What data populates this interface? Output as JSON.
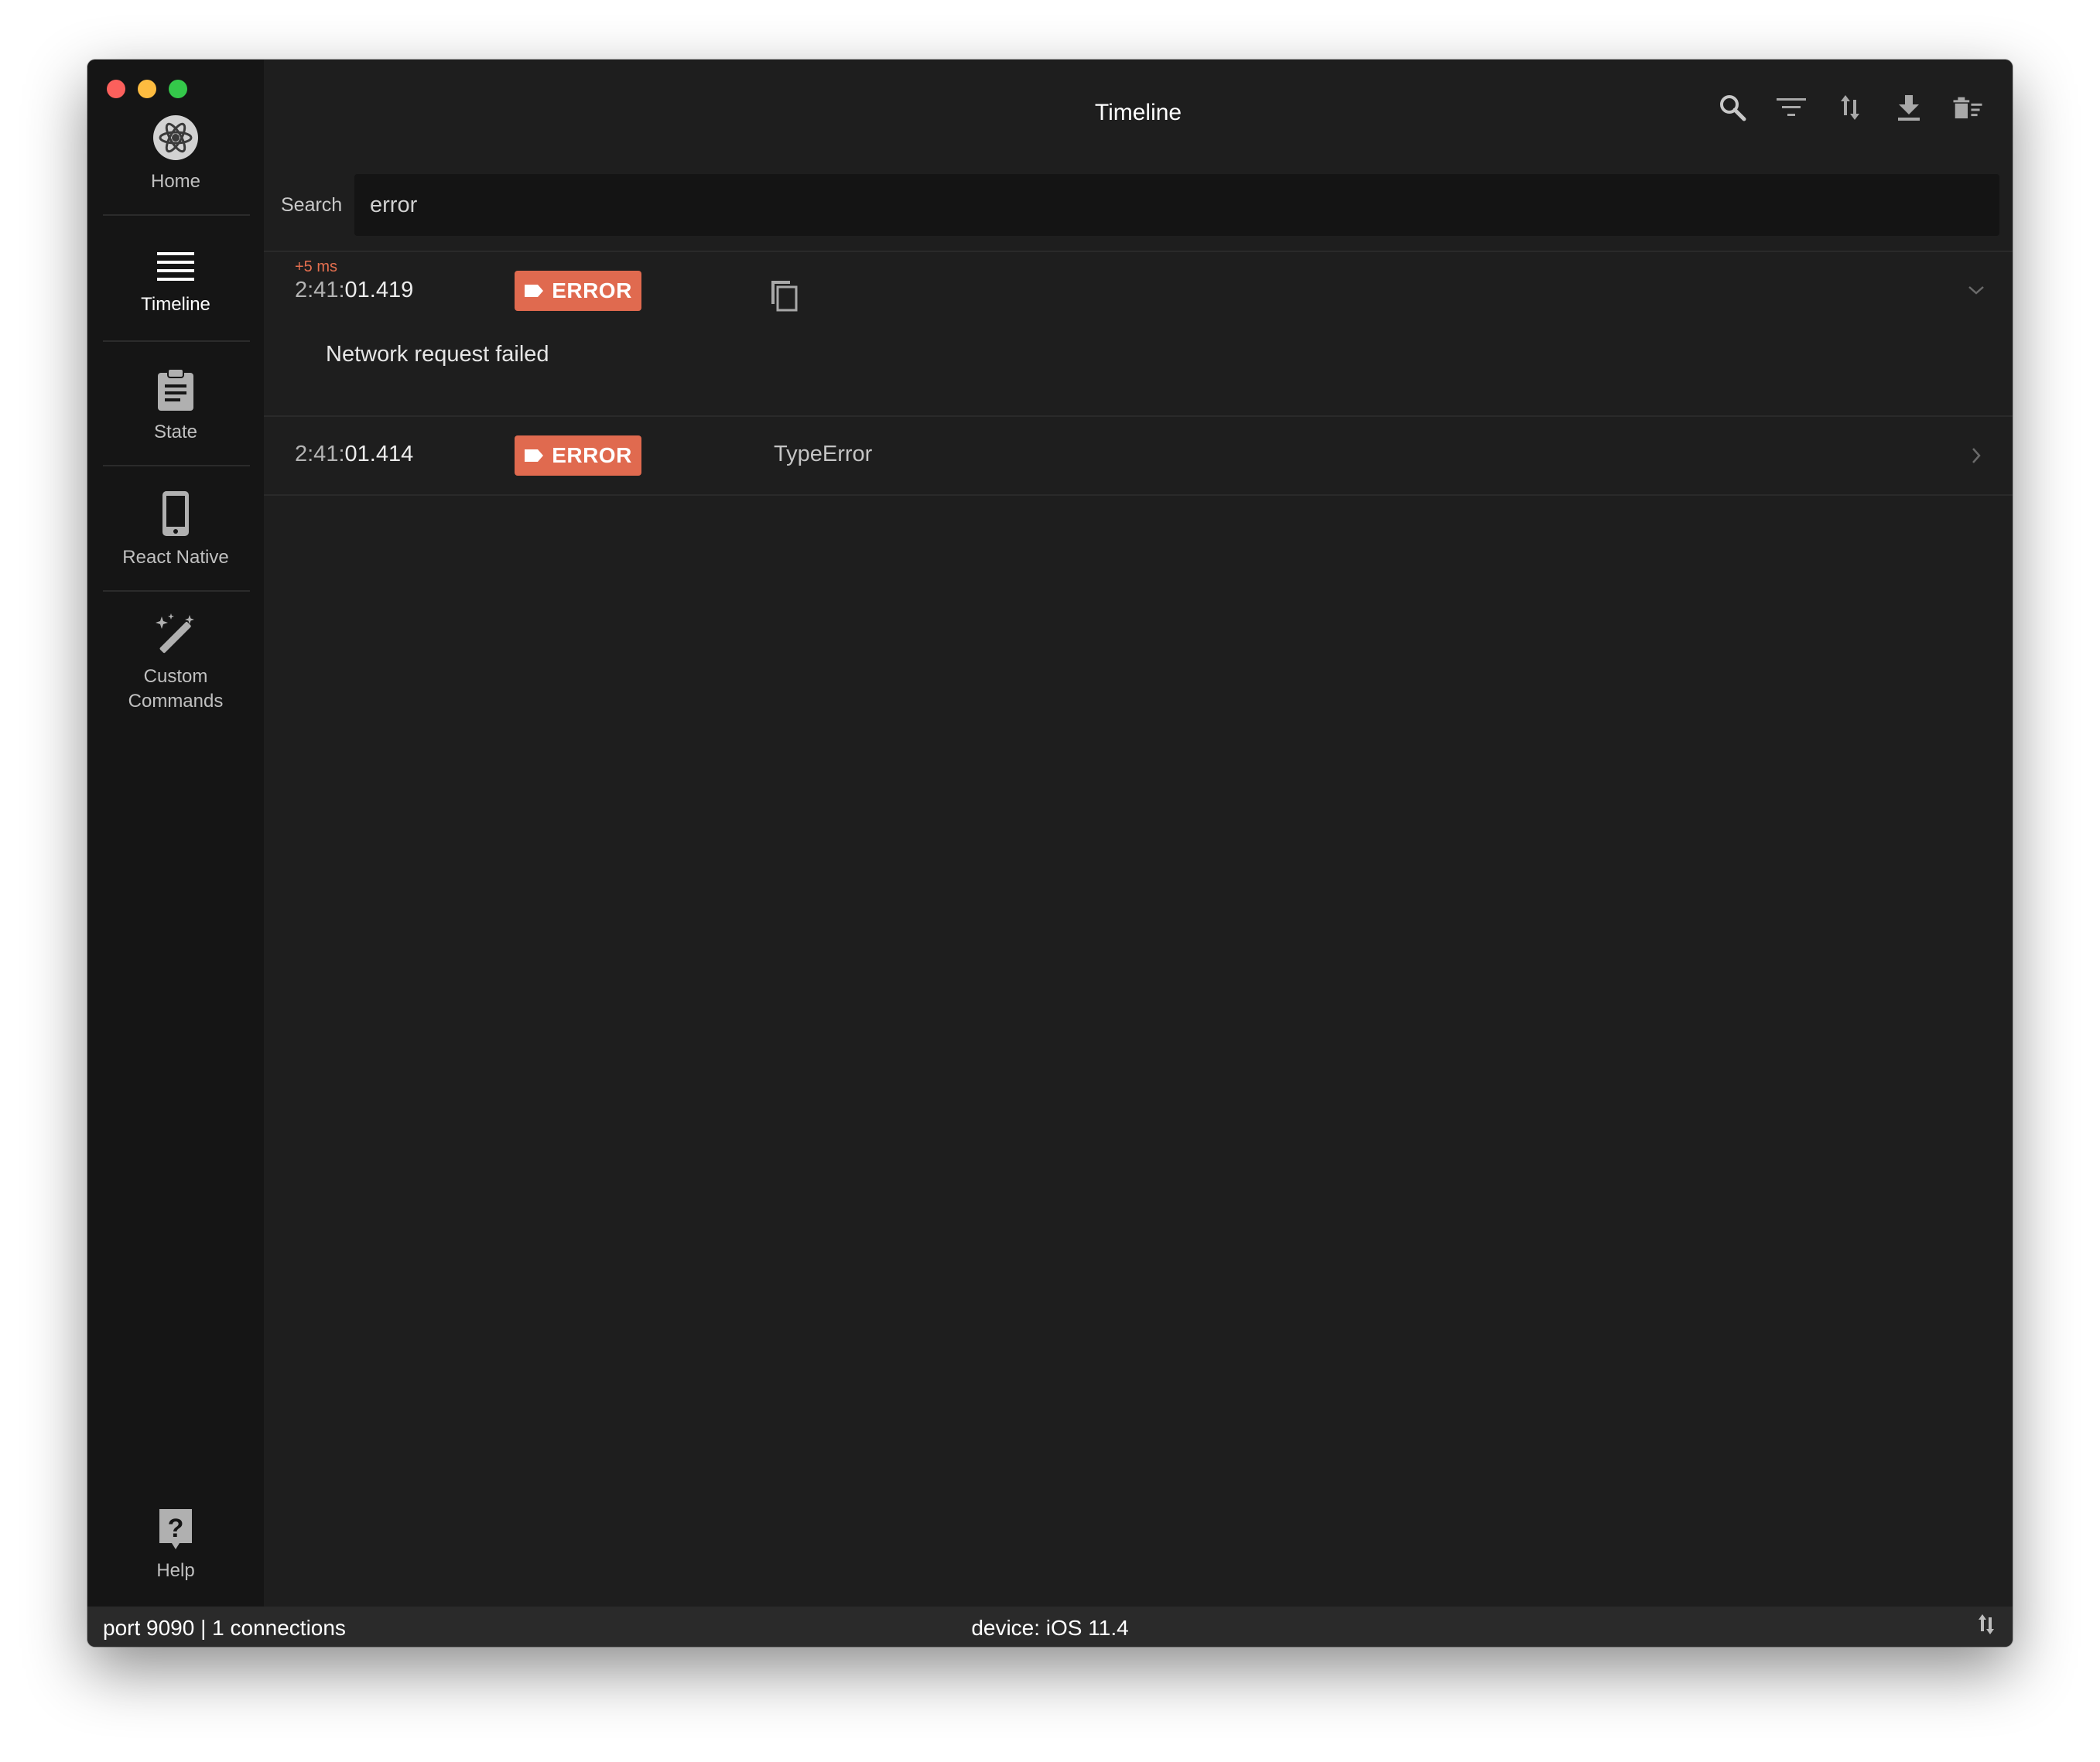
{
  "window": {
    "traffic_lights": [
      "close",
      "minimize",
      "zoom"
    ]
  },
  "sidebar": {
    "items": [
      {
        "label": "Home",
        "icon": "reactotron-logo-icon",
        "active": false
      },
      {
        "label": "Timeline",
        "icon": "list-icon",
        "active": true
      },
      {
        "label": "State",
        "icon": "clipboard-icon",
        "active": false
      },
      {
        "label": "React Native",
        "icon": "phone-icon",
        "active": false
      },
      {
        "label_line1": "Custom",
        "label_line2": "Commands",
        "icon": "magic-wand-icon",
        "active": false
      }
    ],
    "help": {
      "label": "Help",
      "icon": "help-icon"
    }
  },
  "header": {
    "title": "Timeline",
    "toolbar": [
      "search-icon",
      "filter-icon",
      "sort-icon",
      "download-icon",
      "clear-icon"
    ]
  },
  "search": {
    "label": "Search",
    "value": "error"
  },
  "timeline": {
    "entries": [
      {
        "delta": "+5 ms",
        "time_prefix": "2:41:",
        "time_main": "01.419",
        "badge": "ERROR",
        "expanded": true,
        "action_icon": "copy-icon",
        "message": "Network request failed"
      },
      {
        "time_prefix": "2:41:",
        "time_main": "01.414",
        "badge": "ERROR",
        "expanded": false,
        "preview": "TypeError"
      }
    ]
  },
  "statusbar": {
    "left": "port 9090 | 1 connections",
    "center": "device: iOS 11.4",
    "right_icon": "sort-icon"
  },
  "colors": {
    "error_badge": "#e06a4f",
    "delta_text": "#e56f4f",
    "sidebar_bg": "#151515",
    "main_bg": "#1e1e1e",
    "statusbar_bg": "#2a2a2a"
  }
}
